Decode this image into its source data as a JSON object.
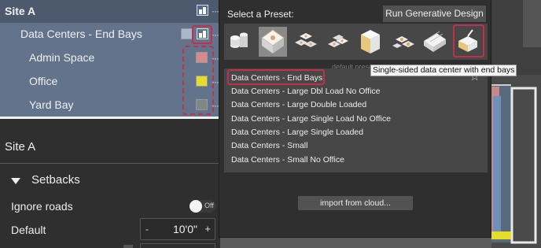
{
  "tree": {
    "site": "Site A",
    "group": "Data Centers - End Bays",
    "children": [
      {
        "label": "Admin Space",
        "color": "#d88a8a"
      },
      {
        "label": "Office",
        "color": "#e6dc2a"
      },
      {
        "label": "Yard Bay",
        "color": "#7f8787"
      }
    ],
    "group_color": "#a8b8cc",
    "more": "···"
  },
  "props": {
    "title": "Site A",
    "section": "Setbacks",
    "ignore_roads_label": "Ignore roads",
    "ignore_roads_state": "Off",
    "default_label": "Default",
    "default_value": "10'0\"",
    "minus": "-",
    "plus": "+"
  },
  "popup": {
    "select_title": "Select a Preset:",
    "run_button": "Run Generative Design",
    "default_preset_label": "default preset",
    "presets": [
      "Data Centers - End Bays",
      "Data Centers - Large Dbl Load No Office",
      "Data Centers - Large Double Loaded",
      "Data Centers - Large Single Load No Office",
      "Data Centers - Large Single Loaded",
      "Data Centers - Small",
      "Data Centers - Small No Office"
    ],
    "selected_index": 0,
    "star": "☆",
    "import_button": "import from cloud...",
    "tooltip": "Single-sided data center with end bays",
    "icons": [
      "cylinder-stack-icon",
      "cross-building-icon",
      "cluster-building-icon",
      "cluster-building-2-icon",
      "tall-cube-icon",
      "multi-building-icon",
      "long-building-icon",
      "end-bay-building-icon"
    ],
    "accent": "#c0304a"
  }
}
